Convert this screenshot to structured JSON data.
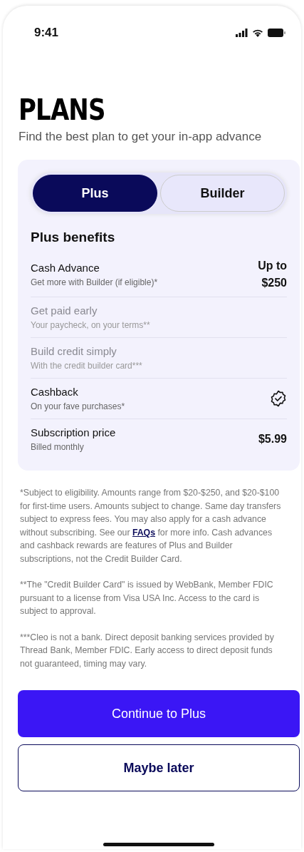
{
  "status_bar": {
    "time": "9:41"
  },
  "header": {
    "title": "PLANS",
    "subtitle": "Find the best plan to get your in-app advance"
  },
  "tabs": [
    {
      "label": "Plus",
      "selected": true
    },
    {
      "label": "Builder",
      "selected": false
    }
  ],
  "benefits": {
    "heading": "Plus benefits",
    "items": [
      {
        "kind": "value",
        "title": "Cash Advance",
        "subtitle": "Get more with Builder (if eligible)*",
        "included": true,
        "value_top": "Up to",
        "value": "$250"
      },
      {
        "kind": "none",
        "title": "Get paid early",
        "subtitle": "Your paycheck, on your terms**",
        "included": false
      },
      {
        "kind": "none",
        "title": "Build credit simply",
        "subtitle": "With the credit builder card***",
        "included": false
      },
      {
        "kind": "check",
        "title": "Cashback",
        "subtitle": "On your fave purchases*",
        "included": true
      },
      {
        "kind": "value",
        "title": "Subscription price",
        "subtitle": "Billed monthly",
        "included": true,
        "value": "$5.99"
      }
    ]
  },
  "footnotes": [
    {
      "text_before": "*Subject to eligibility. Amounts range from $20-$250, and $20-$100 for first-time users. Amounts subject to change. Same day transfers subject to express fees. You may also apply for a cash advance without subscribing. See our ",
      "link": "FAQs",
      "text_after": " for more info. Cash advances and cashback rewards are features of Plus and Builder subscriptions, not the Credit Builder Card."
    },
    {
      "text_before": "**The \"Credit Builder Card\" is issued by WebBank, Member FDIC pursuant to a license from Visa USA Inc. Access to the card is subject to approval."
    },
    {
      "text_before": "***Cleo is not a bank. Direct deposit banking services provided by Thread Bank, Member FDIC. Early access to direct deposit funds not guaranteed, timing may vary."
    }
  ],
  "buttons": [
    {
      "kind": "primary",
      "label": "Continue to Plus"
    },
    {
      "kind": "secondary",
      "label": "Maybe later"
    }
  ]
}
